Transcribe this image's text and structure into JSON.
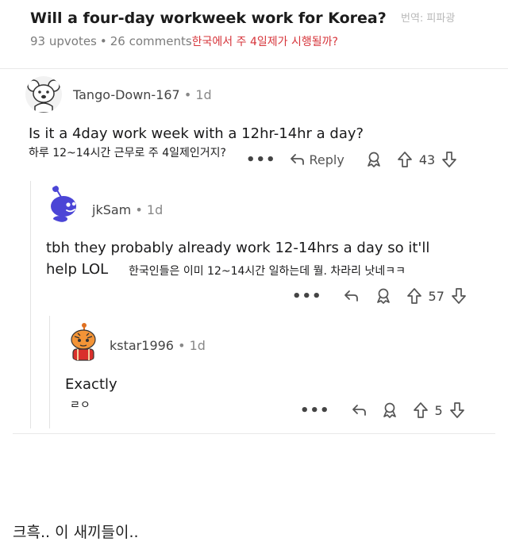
{
  "post": {
    "title": "Will a four-day workweek work for Korea?",
    "translator_note": "번역: 피파광",
    "upvotes": "93 upvotes",
    "comments": "26 comments",
    "title_translation": "한국에서 주 4일제가 시행될까?"
  },
  "comments": [
    {
      "username": "Tango-Down-167",
      "age": "1d",
      "text": "Is it a 4day work week with a 12hr-14hr a day?",
      "translation": "하루 12~14시간 근무로 주 4일제인거지?",
      "reply_label": "Reply",
      "votes": "43"
    },
    {
      "username": "jkSam",
      "age": "1d",
      "text_line1": "tbh they probably already work 12-14hrs a day so it'll",
      "text_line2": "help LOL",
      "translation": "한국인들은 이미 12~14시간 일하는데 뭘. 차라리 낫네ㅋㅋ",
      "votes": "57"
    },
    {
      "username": "kstar1996",
      "age": "1d",
      "text": "Exactly",
      "translation": "ㄹㅇ",
      "votes": "5"
    }
  ],
  "separator": "•",
  "more": "•••",
  "footer_note": "크흑.. 이 새끼들이..",
  "colors": {
    "translation_red": "#d6343a",
    "text": "#1a1a1b",
    "meta": "#7c7c7c"
  }
}
